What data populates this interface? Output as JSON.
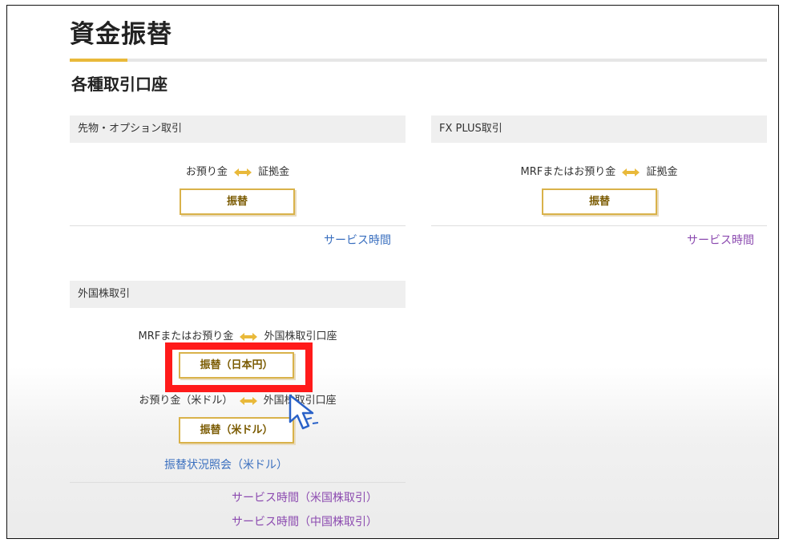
{
  "page": {
    "title": "資金振替",
    "section_title": "各種取引口座"
  },
  "futures_panel": {
    "header": "先物・オプション取引",
    "transfer": {
      "from": "お預り金",
      "to": "証拠金"
    },
    "button_label": "振替",
    "service_link": "サービス時間"
  },
  "fx_panel": {
    "header": "FX PLUS取引",
    "transfer": {
      "from": "MRFまたはお預り金",
      "to": "証拠金"
    },
    "button_label": "振替",
    "service_link": "サービス時間"
  },
  "foreign_panel": {
    "header": "外国株取引",
    "transfer_jpy": {
      "from": "MRFまたはお預り金",
      "to": "外国株取引口座"
    },
    "button_jpy_label": "振替（日本円）",
    "transfer_usd": {
      "from": "お預り金（米ドル）",
      "to": "外国株取引口座"
    },
    "button_usd_label": "振替（米ドル）",
    "status_link": "振替状況照会（米ドル）",
    "service_link_us": "サービス時間（米国株取引）",
    "service_link_cn": "サービス時間（中国株取引）"
  },
  "colors": {
    "accent": "#e9b93a",
    "highlight": "#ff1a1a",
    "link_blue": "#3a6fbf",
    "link_purple": "#8c4bb0"
  },
  "icons": {
    "arrow": "double-arrow-icon",
    "cursor": "mouse-pointer-icon"
  }
}
